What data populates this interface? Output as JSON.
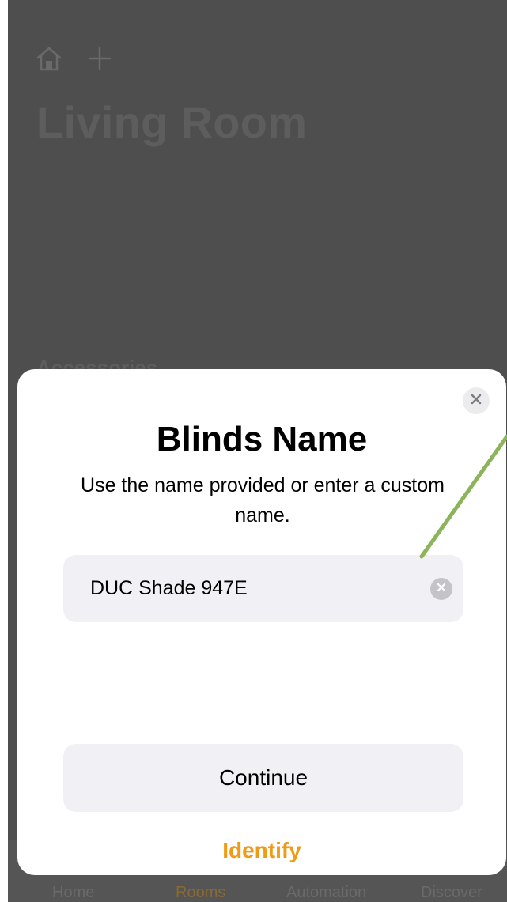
{
  "background": {
    "title": "Living Room",
    "section_label": "Accessories",
    "tabs": [
      "Home",
      "Rooms",
      "Automation",
      "Discover"
    ],
    "active_tab": "Rooms"
  },
  "icons": {
    "home": "house-icon",
    "add": "plus-icon",
    "close": "close-x-icon",
    "clear": "clear-x-icon"
  },
  "dialog": {
    "title": "Blinds Name",
    "subtitle": "Use the name provided or enter a custom name.",
    "name_value": "DUC Shade 947E",
    "continue_label": "Continue",
    "identify_label": "Identify"
  },
  "colors": {
    "accent": "#f09a16",
    "annotation": "#8cb45a",
    "overlay": "#4e4e4e"
  }
}
